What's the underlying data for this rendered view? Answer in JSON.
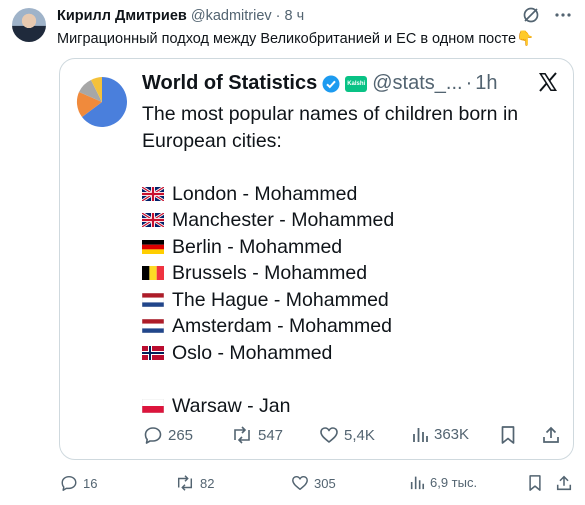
{
  "post": {
    "author_name": "Кирилл Дмитриев",
    "author_handle": "@kadmitriev",
    "separator": "·",
    "time": "8 ч",
    "text": "Миграционный подход между Великобританией и ЕС в одном посте",
    "emoji": "👇"
  },
  "quote": {
    "author_name": "World of Statistics",
    "badge_text": "Kalshi",
    "handle": "@stats_...",
    "separator": "·",
    "time": "1h",
    "intro_line1": "The most popular names of children born in",
    "intro_line2": "European cities:",
    "items": [
      {
        "flag": "uk",
        "text": "London - Mohammed"
      },
      {
        "flag": "uk",
        "text": "Manchester - Mohammed"
      },
      {
        "flag": "de",
        "text": "Berlin - Mohammed"
      },
      {
        "flag": "be",
        "text": "Brussels - Mohammed"
      },
      {
        "flag": "nl",
        "text": "The Hague - Mohammed"
      },
      {
        "flag": "nl",
        "text": "Amsterdam - Mohammed"
      },
      {
        "flag": "no",
        "text": "Oslo - Mohammed"
      },
      {
        "flag": "pl",
        "text": "Warsaw - Jan"
      }
    ],
    "stats": {
      "replies": "265",
      "reposts": "547",
      "likes": "5,4K",
      "views": "363K"
    }
  },
  "stats": {
    "replies": "16",
    "reposts": "82",
    "likes": "305",
    "views": "6,9 тыс."
  },
  "colors": {
    "accent": "#1d9bf0",
    "muted": "#536471",
    "border": "#cfd9de",
    "kalshi": "#09c285"
  },
  "icons": [
    "grok-icon",
    "more-icon",
    "verified-icon",
    "x-logo-icon",
    "reply-icon",
    "repost-icon",
    "like-icon",
    "views-icon",
    "bookmark-icon",
    "share-icon"
  ]
}
